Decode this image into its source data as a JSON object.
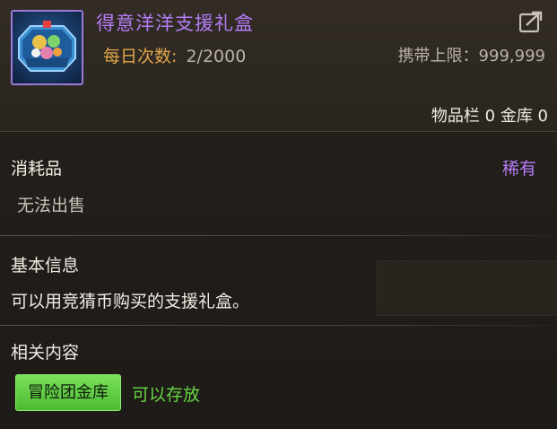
{
  "item": {
    "name": "得意洋洋支援礼盒",
    "daily_label": "每日次数:",
    "daily_value": "2/2000",
    "carry_limit": "携带上限：999,999",
    "inventory": "物品栏 0 金库 0",
    "icon": "gift-box-icon"
  },
  "type_section": {
    "type": "消耗品",
    "rarity": "稀有",
    "sell_status": "无法出售"
  },
  "basic_info": {
    "title": "基本信息",
    "description": "可以用竞猜币购买的支援礼盒。"
  },
  "related": {
    "title": "相关内容",
    "button_label": "冒险团金库",
    "status": "可以存放"
  },
  "colors": {
    "name_purple": "#b57cf5",
    "daily_orange": "#e0a64a",
    "green_button": "#5cc93f",
    "green_text": "#68d442"
  }
}
